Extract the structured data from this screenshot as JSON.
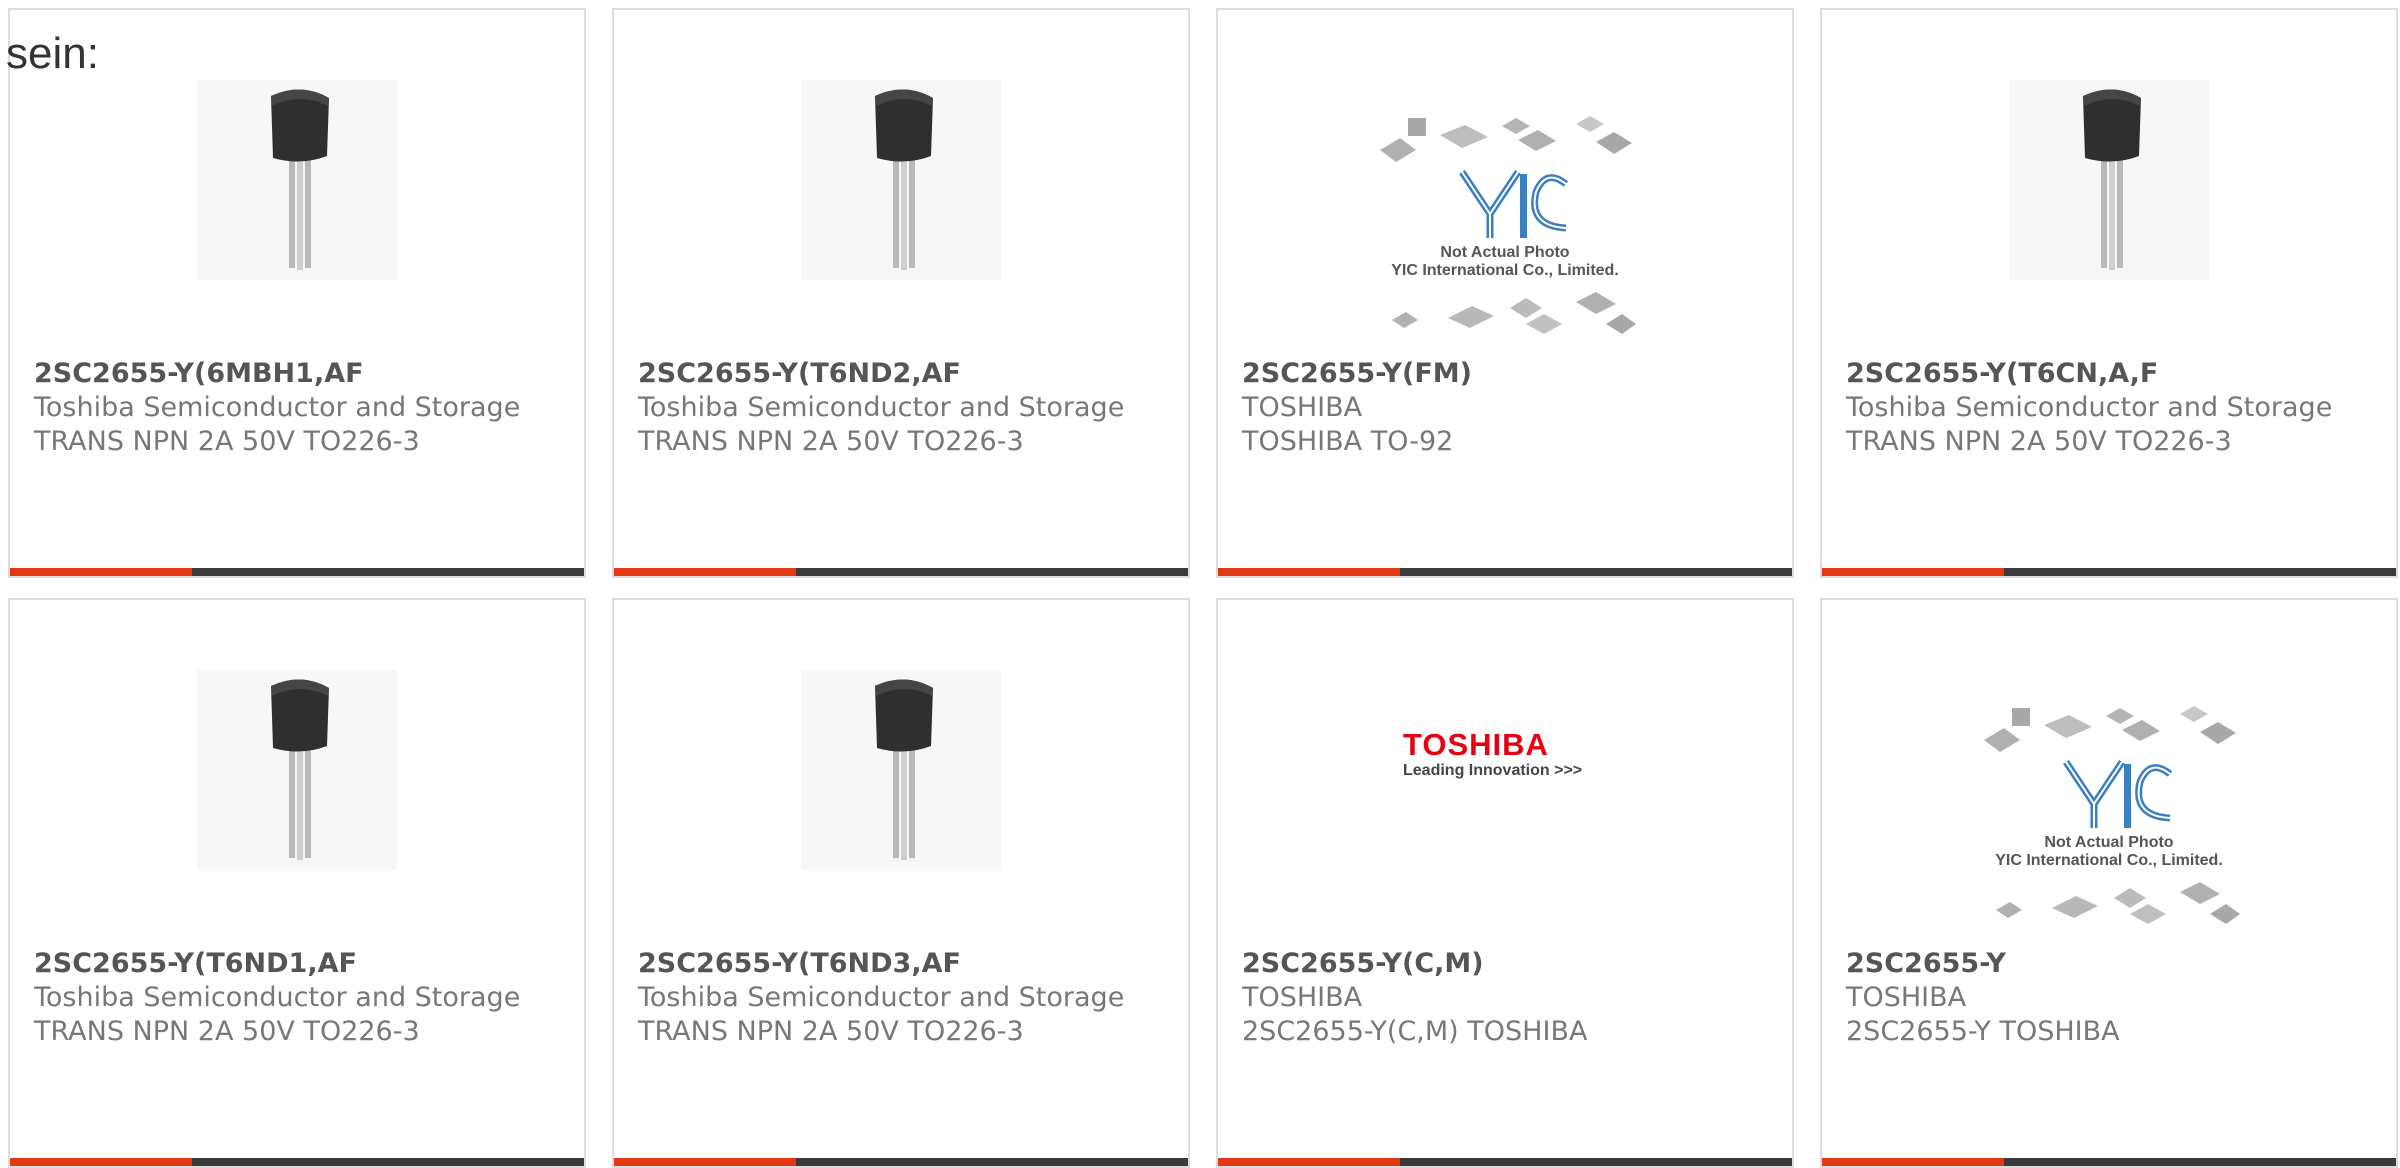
{
  "intro_text": "sein:",
  "accent_color": "#e33814",
  "cards": [
    {
      "title": "2SC2655-Y(6MBH1,AF",
      "manufacturer": "Toshiba Semiconductor and Storage",
      "description": "TRANS NPN 2A 50V TO226-3",
      "image": "transistor-photo"
    },
    {
      "title": "2SC2655-Y(T6ND2,AF",
      "manufacturer": "Toshiba Semiconductor and Storage",
      "description": "TRANS NPN 2A 50V TO226-3",
      "image": "transistor-photo"
    },
    {
      "title": "2SC2655-Y(FM)",
      "manufacturer": "TOSHIBA",
      "description": "TOSHIBA TO-92",
      "image": "yic-placeholder",
      "image_caption_1": "Not Actual Photo",
      "image_caption_2": "YIC International Co., Limited."
    },
    {
      "title": "2SC2655-Y(T6CN,A,F",
      "manufacturer": "Toshiba Semiconductor and Storage",
      "description": "TRANS NPN 2A 50V TO226-3",
      "image": "transistor-photo"
    },
    {
      "title": "2SC2655-Y(T6ND1,AF",
      "manufacturer": "Toshiba Semiconductor and Storage",
      "description": "TRANS NPN 2A 50V TO226-3",
      "image": "transistor-photo"
    },
    {
      "title": "2SC2655-Y(T6ND3,AF",
      "manufacturer": "Toshiba Semiconductor and Storage",
      "description": "TRANS NPN 2A 50V TO226-3",
      "image": "transistor-photo"
    },
    {
      "title": "2SC2655-Y(C,M)",
      "manufacturer": "TOSHIBA",
      "description": "2SC2655-Y(C,M) TOSHIBA",
      "image": "toshiba-logo",
      "logo_word": "TOSHIBA",
      "logo_tagline": "Leading Innovation >>>"
    },
    {
      "title": "2SC2655-Y",
      "manufacturer": "TOSHIBA",
      "description": "2SC2655-Y TOSHIBA",
      "image": "yic-placeholder",
      "image_caption_1": "Not Actual Photo",
      "image_caption_2": "YIC International Co., Limited."
    }
  ]
}
